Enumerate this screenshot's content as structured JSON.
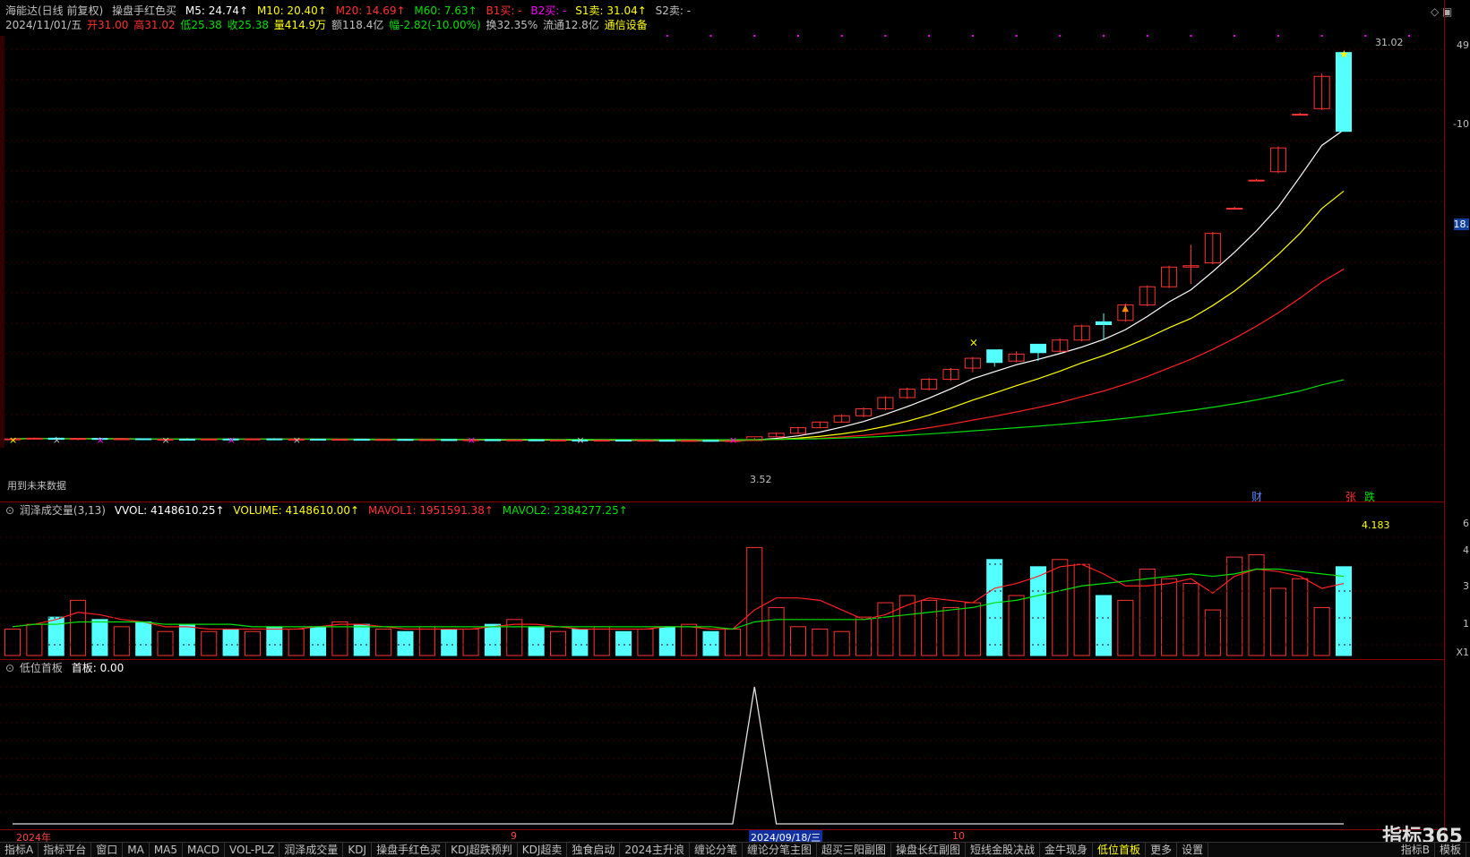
{
  "header": {
    "stock": "海能达(日线 前复权)",
    "indicator": "操盘手红色买",
    "m5": "M5: 24.74↑",
    "m10": "M10: 20.40↑",
    "m20": "M20: 14.69↑",
    "m60": "M60: 7.63↑",
    "b1": "B1买: -",
    "b2": "B2买: -",
    "s1": "S1卖: 31.04↑",
    "s2": "S2卖: -"
  },
  "quote": {
    "date": "2024/11/01/五",
    "open": "开31.00",
    "high": "高31.02",
    "low": "低25.38",
    "close": "收25.38",
    "vol": "量414.9万",
    "amount": "额118.4亿",
    "change": "幅-2.82(-10.00%)",
    "turnover": "换32.35%",
    "float": "流通12.8亿",
    "sector": "通信设备"
  },
  "main_notes": {
    "future": "用到未来数据",
    "low_label": "3.52",
    "high_label": "31.02",
    "cai": "财",
    "zhang": "张",
    "die": "跌"
  },
  "vol_header": {
    "name": "润泽成交量(3,13)",
    "vvol": "VVOL: 4148610.25↑",
    "volume": "VOLUME: 4148610.00↑",
    "mavol1": "MAVOL1: 1951591.38↑",
    "mavol2": "MAVOL2: 2384277.25↑",
    "top_val": "4.183"
  },
  "sub_header": {
    "name": "低位首板",
    "value": "首板: 0.00"
  },
  "right_axis": {
    "a": "49",
    "b": "-10",
    "c": "18.",
    "d": "6",
    "e": "4",
    "f": "3",
    "g": "1",
    "h": "X1"
  },
  "date_axis": {
    "year": "2024年",
    "m9": "9",
    "cursor": "2024/09/18/三",
    "m10": "10"
  },
  "tabs": [
    "指标A",
    "指标平台",
    "窗口",
    "MA",
    "MA5",
    "MACD",
    "VOL-PLZ",
    "润泽成交量",
    "KDJ",
    "操盘手红色买",
    "KDJ超跌预判",
    "KDJ超卖",
    "独食启动",
    "2024主升浪",
    "缠论分笔",
    "缠论分笔主图",
    "超买三阳副图",
    "操盘长红副图",
    "短线金股决战",
    "金牛现身",
    "低位首板",
    "更多",
    "设置"
  ],
  "tabs_right": [
    "指标B",
    "模板"
  ],
  "watermark": "指标365",
  "colors": {
    "up": "#ff3232",
    "down": "#54ffff",
    "ma5": "#ffffff",
    "ma10": "#ffff00",
    "ma20": "#ff2020",
    "ma60": "#00e000"
  },
  "chart_data": {
    "type": "candlestick",
    "candles": [
      [
        3.4,
        3.5,
        3.3,
        3.45
      ],
      [
        3.45,
        3.55,
        3.4,
        3.5
      ],
      [
        3.5,
        3.6,
        3.4,
        3.42
      ],
      [
        3.42,
        3.5,
        3.35,
        3.48
      ],
      [
        3.48,
        3.55,
        3.4,
        3.44
      ],
      [
        3.44,
        3.5,
        3.4,
        3.46
      ],
      [
        3.46,
        3.5,
        3.38,
        3.4
      ],
      [
        3.4,
        3.45,
        3.35,
        3.43
      ],
      [
        3.43,
        3.5,
        3.38,
        3.41
      ],
      [
        3.41,
        3.46,
        3.37,
        3.44
      ],
      [
        3.44,
        3.5,
        3.4,
        3.42
      ],
      [
        3.42,
        3.48,
        3.38,
        3.45
      ],
      [
        3.45,
        3.5,
        3.4,
        3.41
      ],
      [
        3.41,
        3.46,
        3.36,
        3.43
      ],
      [
        3.43,
        3.48,
        3.39,
        3.4
      ],
      [
        3.4,
        3.44,
        3.35,
        3.42
      ],
      [
        3.42,
        3.47,
        3.38,
        3.39
      ],
      [
        3.39,
        3.44,
        3.35,
        3.41
      ],
      [
        3.41,
        3.45,
        3.37,
        3.38
      ],
      [
        3.38,
        3.42,
        3.33,
        3.4
      ],
      [
        3.4,
        3.44,
        3.35,
        3.37
      ],
      [
        3.37,
        3.42,
        3.33,
        3.39
      ],
      [
        3.39,
        3.43,
        3.35,
        3.36
      ],
      [
        3.36,
        3.4,
        3.32,
        3.38
      ],
      [
        3.38,
        3.42,
        3.34,
        3.35
      ],
      [
        3.35,
        3.4,
        3.3,
        3.37
      ],
      [
        3.37,
        3.41,
        3.33,
        3.34
      ],
      [
        3.34,
        3.38,
        3.3,
        3.36
      ],
      [
        3.36,
        3.4,
        3.32,
        3.33
      ],
      [
        3.33,
        3.37,
        3.29,
        3.35
      ],
      [
        3.35,
        3.4,
        3.3,
        3.32
      ],
      [
        3.32,
        3.36,
        3.28,
        3.34
      ],
      [
        3.34,
        3.38,
        3.3,
        3.31
      ],
      [
        3.31,
        3.35,
        3.27,
        3.33
      ],
      [
        3.33,
        3.37,
        3.52,
        3.6
      ],
      [
        3.6,
        3.9,
        3.55,
        3.85
      ],
      [
        3.85,
        4.3,
        3.8,
        4.25
      ],
      [
        4.25,
        4.7,
        4.2,
        4.65
      ],
      [
        4.65,
        5.2,
        4.6,
        5.1
      ],
      [
        5.1,
        5.7,
        5.0,
        5.6
      ],
      [
        5.6,
        6.5,
        5.5,
        6.4
      ],
      [
        6.4,
        7.1,
        6.3,
        7.0
      ],
      [
        7.0,
        7.8,
        6.9,
        7.7
      ],
      [
        7.7,
        8.5,
        7.6,
        8.4
      ],
      [
        8.5,
        9.3,
        8.2,
        9.2
      ],
      [
        9.8,
        9.4,
        8.6,
        8.9
      ],
      [
        9.0,
        9.7,
        8.9,
        9.5
      ],
      [
        10.2,
        9.9,
        9.0,
        9.6
      ],
      [
        9.7,
        10.6,
        9.6,
        10.5
      ],
      [
        10.5,
        11.6,
        10.4,
        11.5
      ],
      [
        11.8,
        12.4,
        10.5,
        11.6
      ],
      [
        11.9,
        13.1,
        11.8,
        13.0
      ],
      [
        13.0,
        14.4,
        12.9,
        14.3
      ],
      [
        14.3,
        15.8,
        14.2,
        15.7
      ],
      [
        15.7,
        17.3,
        14.5,
        15.8
      ],
      [
        16.0,
        18.2,
        15.9,
        18.1
      ],
      [
        19.9,
        20.0,
        19.9,
        19.9
      ],
      [
        21.9,
        22.0,
        21.9,
        21.9
      ],
      [
        22.5,
        24.3,
        22.4,
        24.2
      ],
      [
        26.6,
        26.7,
        26.6,
        26.6
      ],
      [
        27.0,
        29.5,
        26.9,
        29.3
      ],
      [
        31.0,
        31.02,
        25.38,
        25.38
      ]
    ],
    "volume": [
      1.1,
      1.3,
      1.6,
      2.3,
      1.5,
      1.2,
      1.4,
      1.0,
      1.3,
      1.0,
      1.1,
      1.0,
      1.2,
      1.1,
      1.2,
      1.4,
      1.3,
      1.1,
      1.0,
      1.2,
      1.1,
      1.1,
      1.3,
      1.5,
      1.2,
      1.0,
      1.1,
      1.2,
      1.0,
      1.1,
      1.2,
      1.3,
      1.0,
      1.1,
      4.5,
      2.0,
      1.2,
      1.1,
      1.0,
      1.6,
      2.2,
      2.5,
      2.3,
      2.0,
      2.2,
      4.0,
      2.5,
      3.7,
      4.0,
      3.8,
      2.5,
      2.3,
      3.6,
      3.2,
      3.0,
      1.9,
      4.1,
      4.2,
      2.8,
      3.2,
      2.0,
      3.7
    ],
    "series": [
      {
        "name": "MAVOL1",
        "values": [
          1.2,
          1.3,
          1.5,
          1.8,
          1.7,
          1.5,
          1.4,
          1.2,
          1.2,
          1.1,
          1.1,
          1.1,
          1.1,
          1.1,
          1.2,
          1.3,
          1.3,
          1.2,
          1.1,
          1.1,
          1.1,
          1.1,
          1.2,
          1.3,
          1.3,
          1.2,
          1.1,
          1.1,
          1.1,
          1.1,
          1.2,
          1.2,
          1.1,
          1.1,
          1.9,
          2.4,
          2.4,
          2.3,
          1.9,
          1.5,
          1.7,
          2.1,
          2.4,
          2.3,
          2.2,
          2.8,
          3.0,
          3.3,
          3.7,
          3.8,
          3.4,
          2.9,
          2.9,
          3.0,
          3.2,
          2.6,
          3.3,
          3.6,
          3.5,
          3.3,
          2.8,
          3.0
        ]
      },
      {
        "name": "MAVOL2",
        "values": [
          1.2,
          1.3,
          1.3,
          1.4,
          1.4,
          1.4,
          1.4,
          1.3,
          1.3,
          1.3,
          1.3,
          1.2,
          1.2,
          1.2,
          1.2,
          1.2,
          1.2,
          1.2,
          1.2,
          1.2,
          1.2,
          1.2,
          1.2,
          1.2,
          1.2,
          1.2,
          1.2,
          1.2,
          1.2,
          1.2,
          1.2,
          1.2,
          1.2,
          1.1,
          1.4,
          1.5,
          1.5,
          1.5,
          1.5,
          1.5,
          1.6,
          1.7,
          1.8,
          1.9,
          2.0,
          2.2,
          2.3,
          2.5,
          2.7,
          2.9,
          3.0,
          3.1,
          3.2,
          3.3,
          3.4,
          3.3,
          3.4,
          3.6,
          3.6,
          3.5,
          3.4,
          3.3
        ]
      }
    ],
    "subchart": {
      "name": "首板",
      "values": [
        0,
        0,
        0,
        0,
        0,
        0,
        0,
        0,
        0,
        0,
        0,
        0,
        0,
        0,
        0,
        0,
        0,
        0,
        0,
        0,
        0,
        0,
        0,
        0,
        0,
        0,
        0,
        0,
        0,
        0,
        0,
        0,
        0,
        0,
        1,
        0,
        0,
        0,
        0,
        0,
        0,
        0,
        0,
        0,
        0,
        0,
        0,
        0,
        0,
        0,
        0,
        0,
        0,
        0,
        0,
        0,
        0,
        0,
        0,
        0,
        0,
        0
      ]
    }
  }
}
